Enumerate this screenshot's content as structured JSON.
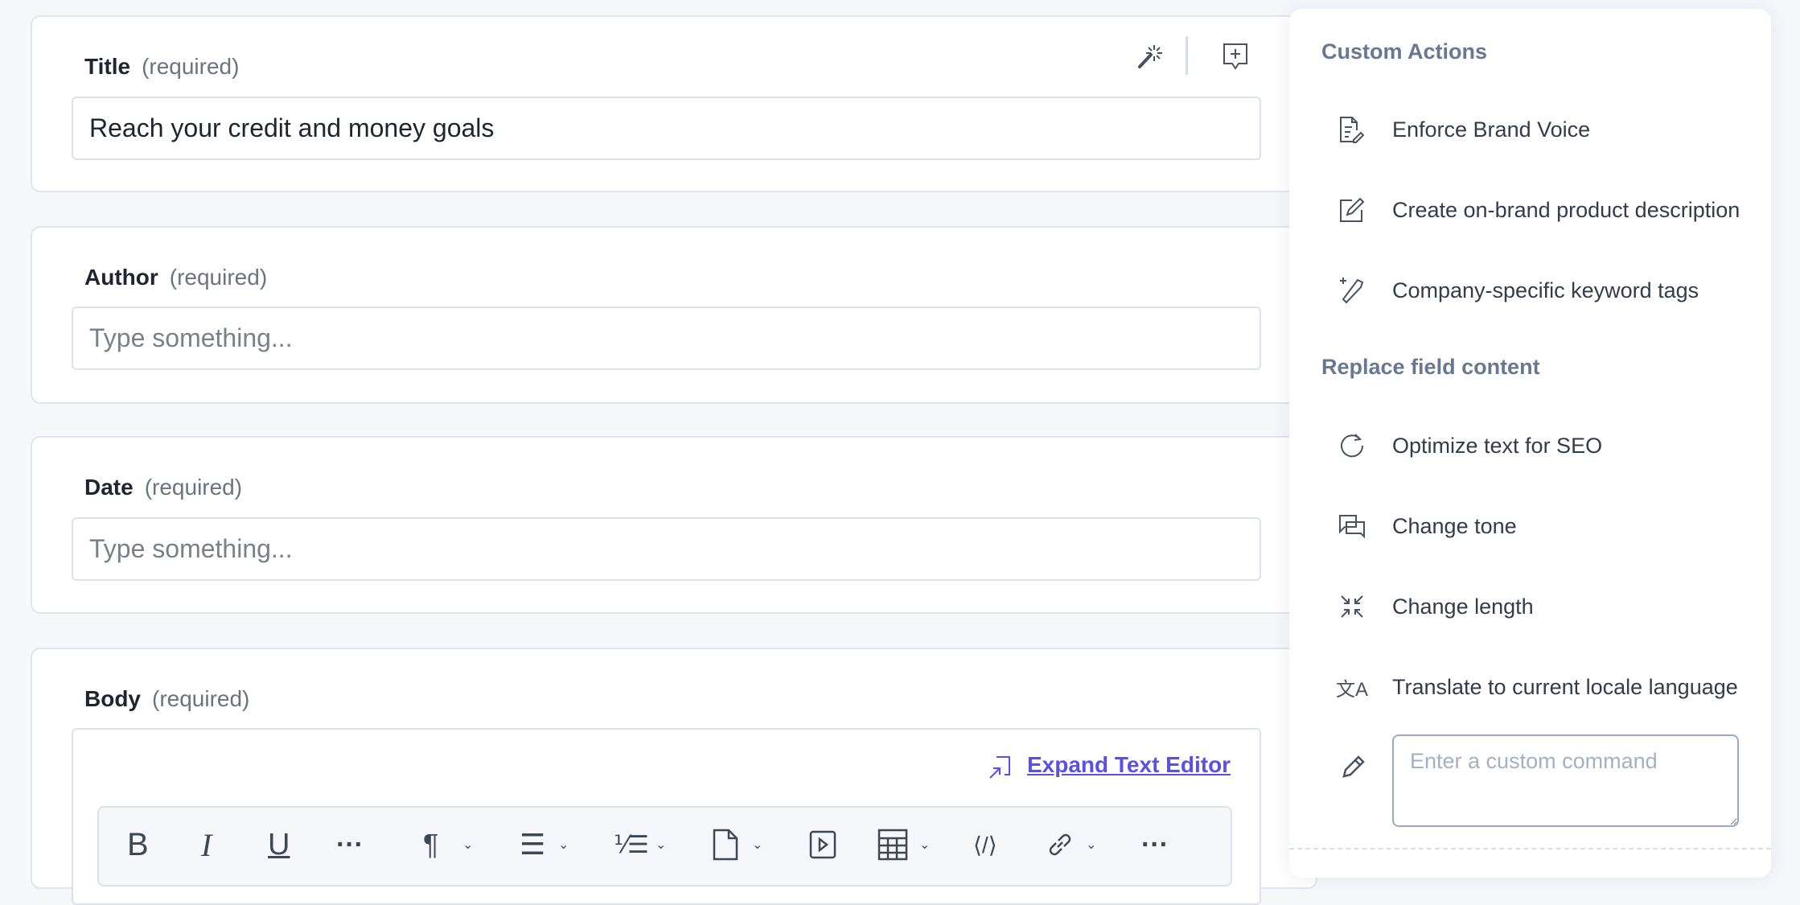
{
  "fields": [
    {
      "label": "Title",
      "required": "(required)",
      "value": "Reach your credit and money goals",
      "placeholder": "Type something..."
    },
    {
      "label": "Author",
      "required": "(required)",
      "value": "",
      "placeholder": "Type something..."
    },
    {
      "label": "Date",
      "required": "(required)",
      "value": "",
      "placeholder": "Type something..."
    },
    {
      "label": "Body",
      "required": "(required)"
    }
  ],
  "editor": {
    "expand_label": "Expand Text Editor",
    "toolbar": [
      "bold",
      "italic",
      "underline",
      "more",
      "paragraph",
      "align",
      "numbered-list",
      "document",
      "media",
      "table",
      "code",
      "link",
      "more"
    ]
  },
  "panel": {
    "custom_heading": "Custom Actions",
    "custom_items": [
      {
        "label": "Enforce Brand Voice",
        "icon": "document-edit-icon"
      },
      {
        "label": "Create on-brand product description",
        "icon": "edit-square-icon"
      },
      {
        "label": "Company-specific keyword tags",
        "icon": "tag-plus-icon"
      }
    ],
    "replace_heading": "Replace field content",
    "replace_items": [
      {
        "label": "Optimize text for SEO",
        "icon": "refresh-icon"
      },
      {
        "label": "Change tone",
        "icon": "chat-bubbles-icon"
      },
      {
        "label": "Change length",
        "icon": "compress-icon"
      },
      {
        "label": "Translate to current locale language",
        "icon": "translate-icon"
      }
    ],
    "custom_command_placeholder": "Enter a custom command"
  },
  "colors": {
    "accent": "#5b50e6",
    "heading": "#687792"
  }
}
